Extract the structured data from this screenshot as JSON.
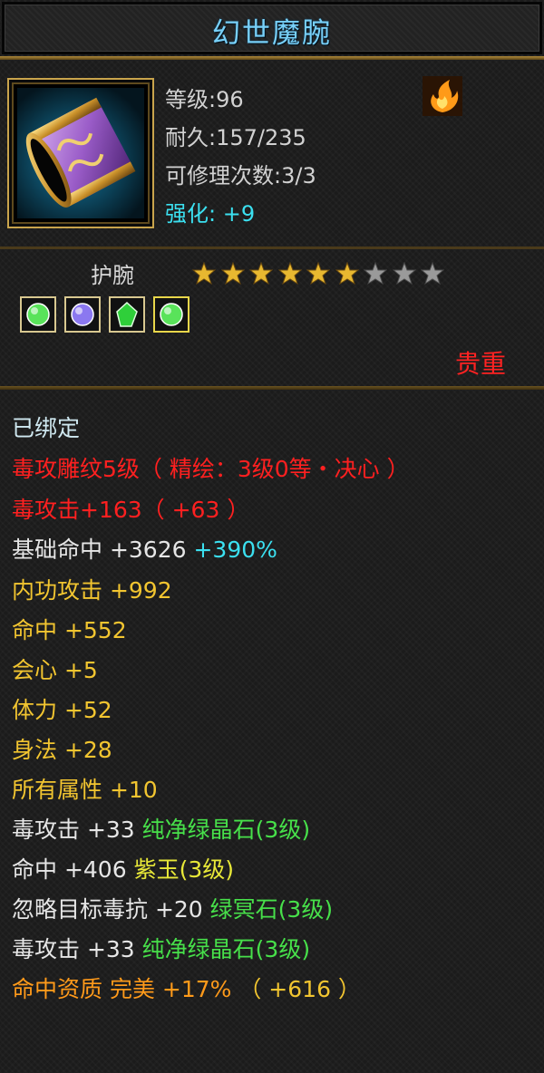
{
  "title": "幻世魔腕",
  "item": {
    "icon": "purple-gold-bracer-icon",
    "level_label": "等级:",
    "level": "96",
    "durability_label": "耐久:",
    "durability": "157/235",
    "repair_label": "可修理次数:",
    "repair": "3/3",
    "enhance_label": "强化:",
    "enhance": "+9",
    "element_icon": "fire-flame-icon"
  },
  "type_label": "护腕",
  "stars": {
    "filled": 6,
    "total": 9
  },
  "gems": [
    {
      "icon": "green-round-gem-icon",
      "color": "#59e35a"
    },
    {
      "icon": "purple-round-gem-icon",
      "color": "#8b78f0"
    },
    {
      "icon": "green-crystal-gem-icon",
      "color": "#2fcf3a"
    },
    {
      "icon": "green-round-gem-icon",
      "color": "#59e35a"
    }
  ],
  "rarity": "贵重",
  "lines": [
    {
      "parts": [
        "已绑定"
      ]
    },
    {
      "parts": [
        "毒攻雕纹5级（ 精绘：3级0等・决心 ）"
      ]
    },
    {
      "parts": [
        "毒攻击+163（ +63 ）"
      ]
    },
    {
      "parts": [
        "基础命中 +3626 ",
        "+390%"
      ]
    },
    {
      "parts": [
        "内功攻击 +992"
      ]
    },
    {
      "parts": [
        "命中 +552"
      ]
    },
    {
      "parts": [
        "会心 +5"
      ]
    },
    {
      "parts": [
        "体力 +52"
      ]
    },
    {
      "parts": [
        "身法 +28"
      ]
    },
    {
      "parts": [
        "所有属性 +10"
      ]
    },
    {
      "parts": [
        "毒攻击 +33 ",
        "纯净绿晶石(3级)"
      ]
    },
    {
      "parts": [
        "命中 +406 ",
        "紫玉(3级)"
      ]
    },
    {
      "parts": [
        "忽略目标毒抗 +20 ",
        "绿冥石(3级)"
      ]
    },
    {
      "parts": [
        "毒攻击 +33 ",
        "纯净绿晶石(3级)"
      ]
    },
    {
      "parts": [
        "命中资质  完美 +17% ",
        "（ +616 ）"
      ]
    }
  ],
  "colors": {
    "title": "#78d0f8",
    "stat": "#d2d2d2",
    "enhance": "#3be0f0",
    "red": "#ff2020",
    "yellow": "#f2c530",
    "cyan": "#3be0f0",
    "green": "#47e04a",
    "orange": "#ff9a1a",
    "star_gold": "#e8b830",
    "star_grey": "#9a9a9a"
  }
}
